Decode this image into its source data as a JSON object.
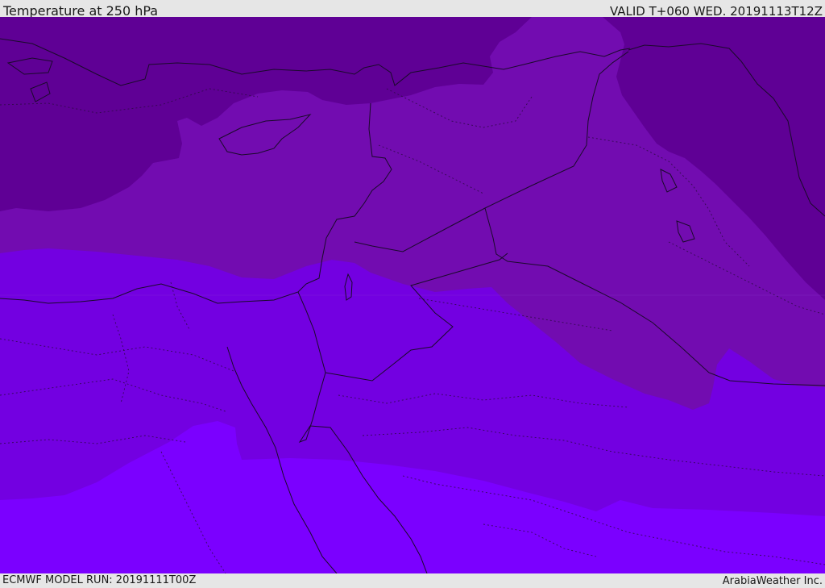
{
  "header": {
    "title": "Temperature at 250 hPa",
    "valid": "VALID T+060 WED. 20191113T12Z"
  },
  "footer": {
    "model_run": "ECMWF MODEL RUN: 20191111T00Z",
    "credit": "ArabiaWeather Inc."
  },
  "map": {
    "field": "temperature",
    "pressure_level_hpa": 250,
    "colors": {
      "coldest": "#5f0095",
      "cold": "#720cb0",
      "mid": "#7300e1",
      "warm": "#7b00ff",
      "border_line": "#1a0a2a"
    }
  }
}
